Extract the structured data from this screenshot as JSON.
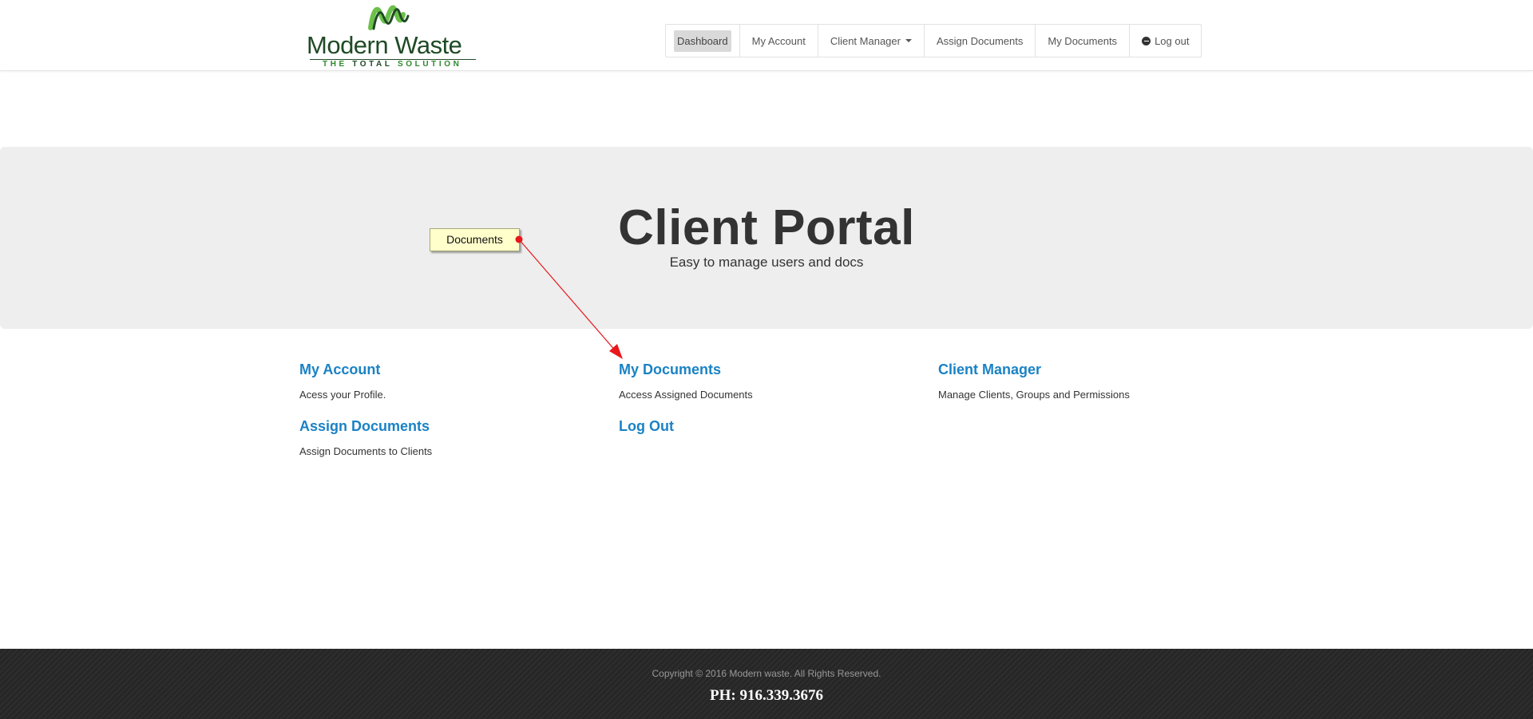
{
  "brand": {
    "name": "Modern Waste",
    "tagline_pre": "THE ",
    "tagline_bold": "TOTAL",
    "tagline_post": " SOLUTION",
    "colors": {
      "dark_green": "#1f4a25",
      "light_green": "#6cc04a",
      "mid_green": "#2d8a2a"
    }
  },
  "nav": {
    "items": [
      {
        "label": "Dashboard"
      },
      {
        "label": "My Account"
      },
      {
        "label": "Client Manager"
      },
      {
        "label": "Assign Documents"
      },
      {
        "label": "My Documents"
      },
      {
        "label": "Log out"
      }
    ]
  },
  "hero": {
    "title": "Client Portal",
    "subtitle": "Easy to manage users and docs"
  },
  "annotation": {
    "label": "Documents",
    "color": "#e8171c"
  },
  "features": [
    {
      "title": "My Account",
      "description": "Acess your Profile."
    },
    {
      "title": "My Documents",
      "description": "Access Assigned Documents"
    },
    {
      "title": "Client Manager",
      "description": "Manage Clients, Groups and Permissions"
    },
    {
      "title": "Assign Documents",
      "description": "Assign Documents to Clients"
    },
    {
      "title": "Log Out",
      "description": ""
    }
  ],
  "footer": {
    "copyright": "Copyright © 2016 Modern waste. All Rights Reserved.",
    "phone": "PH: 916.339.3676"
  },
  "colors": {
    "link_blue": "#1a82c5",
    "hero_bg": "#eeeeee",
    "footer_bg": "#262626"
  }
}
